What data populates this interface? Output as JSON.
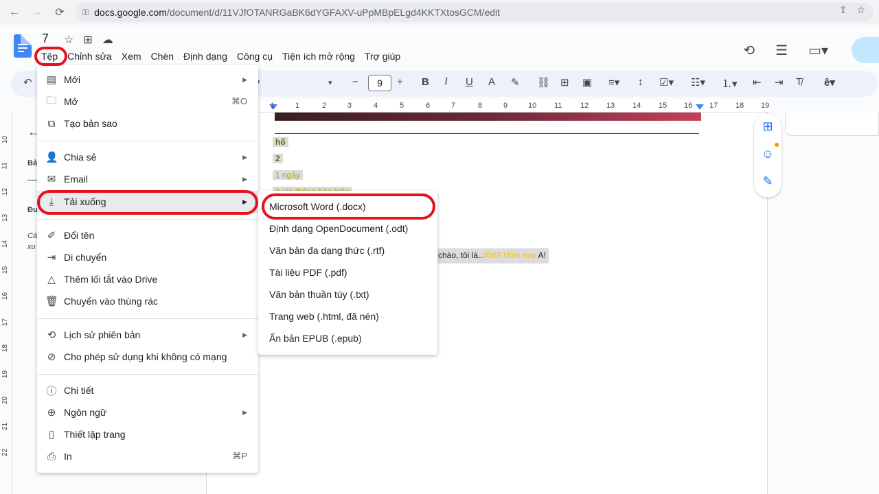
{
  "browser": {
    "url_host": "docs.google.com",
    "url_path": "/document/d/11VJfOTANRGaBK6dYGFAXV-uPpMBpELgd4KKTXtosGCM/edit"
  },
  "doc": {
    "title": "7"
  },
  "menu": [
    "Tệp",
    "Chỉnh sửa",
    "Xem",
    "Chèn",
    "Định dạng",
    "Công cụ",
    "Tiện ích mở rộng",
    "Trợ giúp"
  ],
  "toolbar": {
    "font_size": "9"
  },
  "ruler": [
    "1",
    "1",
    "2",
    "3",
    "4",
    "5",
    "6",
    "7",
    "8",
    "9",
    "10",
    "11",
    "12",
    "13",
    "14",
    "15",
    "16",
    "17",
    "18",
    "19"
  ],
  "vruler": [
    "10",
    "11",
    "12",
    "13",
    "14",
    "15",
    "16",
    "17",
    "18",
    "19",
    "20",
    "21",
    "22"
  ],
  "outline": {
    "item1": "Bả",
    "item2": "Đư",
    "item3": "Cá",
    "item4": "xu"
  },
  "page": {
    "line1": "hố",
    "line2": "2",
    "line3": "1 ngày",
    "line4": "ô xin thông báo hiện",
    "greeting": "chào, tôi là..",
    "greeting_hl": "0049 Hôm nay",
    "greeting_end": " A!"
  },
  "file_menu": {
    "new": "Mới",
    "open": "Mở",
    "open_shortcut": "⌘O",
    "copy": "Tạo bản sao",
    "share": "Chia sẻ",
    "email": "Email",
    "download": "Tải xuống",
    "rename": "Đổi tên",
    "move": "Di chuyển",
    "shortcut": "Thêm lối tắt vào Drive",
    "trash": "Chuyển vào thùng rác",
    "history": "Lịch sử phiên bản",
    "offline": "Cho phép sử dụng khi không có mạng",
    "details": "Chi tiết",
    "language": "Ngôn ngữ",
    "page_setup": "Thiết lập trang",
    "print": "In",
    "print_shortcut": "⌘P"
  },
  "download_menu": [
    "Microsoft Word (.docx)",
    "Định dạng OpenDocument (.odt)",
    "Văn bản đa dạng thức (.rtf)",
    "Tài liệu PDF (.pdf)",
    "Văn bản thuần túy (.txt)",
    "Trang web (.html, đã nén)",
    "Ấn bản EPUB (.epub)"
  ],
  "colors": {
    "accent": "#1a73e8",
    "highlight_ring": "#e8101b"
  }
}
